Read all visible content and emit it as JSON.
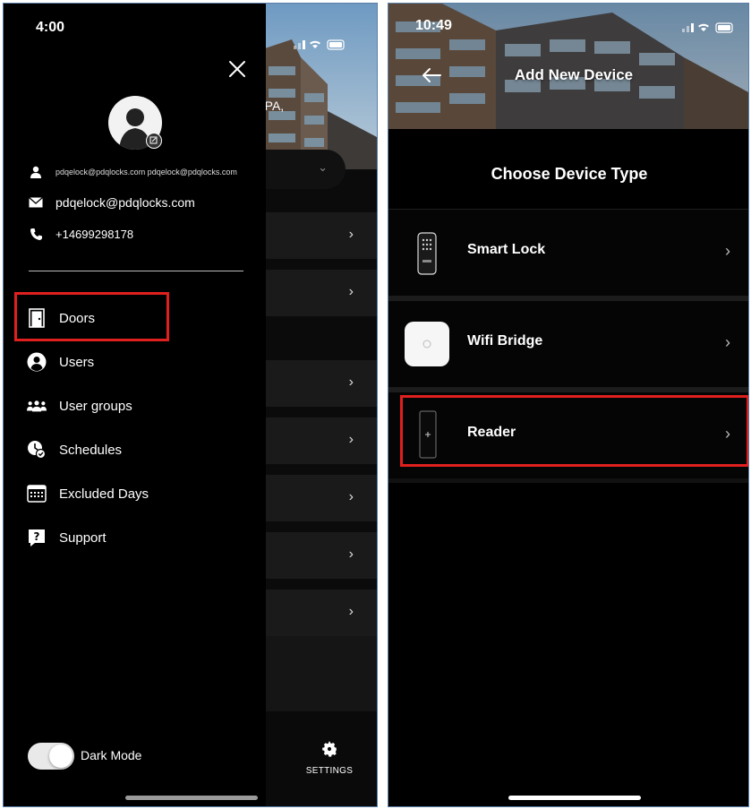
{
  "left_screen": {
    "status_time": "4:00",
    "background": {
      "location_fragment": "r, PA,",
      "settings_label": "SETTINGS"
    },
    "drawer": {
      "username": "pdqelock@pdqlocks.com pdqelock@pdqlocks.com",
      "email": "pdqelock@pdqlocks.com",
      "phone": "+14699298178",
      "menu": [
        {
          "label": "Doors",
          "icon": "door-icon"
        },
        {
          "label": "Users",
          "icon": "user-circle-icon"
        },
        {
          "label": "User groups",
          "icon": "user-groups-icon"
        },
        {
          "label": "Schedules",
          "icon": "schedule-icon"
        },
        {
          "label": "Excluded Days",
          "icon": "calendar-icon"
        },
        {
          "label": "Support",
          "icon": "help-icon"
        }
      ],
      "dark_mode_label": "Dark Mode",
      "dark_mode_on": true
    }
  },
  "right_screen": {
    "status_time": "10:49",
    "header_title": "Add New Device",
    "section_title": "Choose Device Type",
    "devices": [
      {
        "label": "Smart Lock",
        "icon": "smart-lock-icon"
      },
      {
        "label": "Wifi Bridge",
        "icon": "wifi-bridge-icon"
      },
      {
        "label": "Reader",
        "icon": "reader-icon"
      }
    ]
  },
  "colors": {
    "background": "#000000",
    "highlight": "#e0201f",
    "text": "#ffffff"
  }
}
